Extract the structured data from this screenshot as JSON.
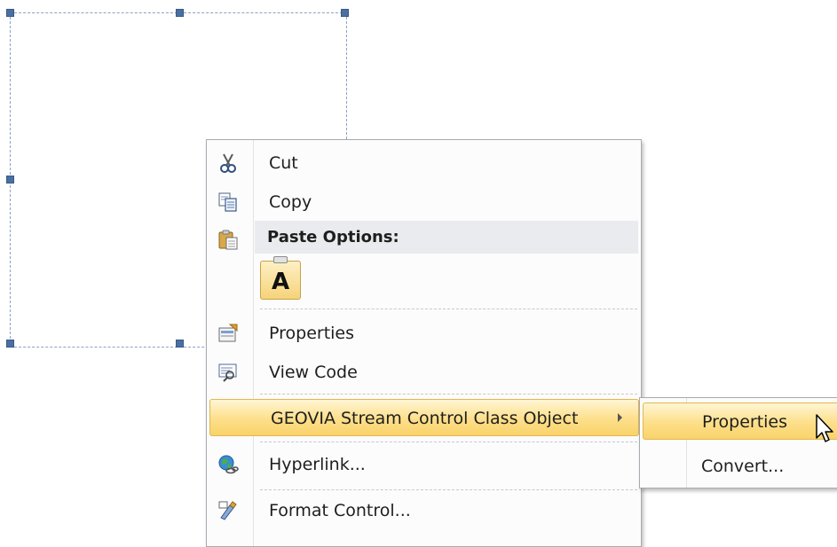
{
  "context_menu": {
    "items": {
      "cut": {
        "label": "Cut",
        "icon": "scissors-icon"
      },
      "copy": {
        "label": "Copy",
        "icon": "copy-icon"
      },
      "paste_options_header": {
        "label": "Paste Options:",
        "icon": "paste-icon"
      },
      "paste_keep_text": {
        "glyph": "A",
        "icon": "paste-keep-text-icon"
      },
      "properties": {
        "label": "Properties",
        "icon": "properties-icon"
      },
      "view_code": {
        "label": "View Code",
        "icon": "view-code-icon"
      },
      "object": {
        "label": "GEOVIA Stream Control Class Object",
        "has_submenu": true
      },
      "hyperlink": {
        "label": "Hyperlink...",
        "icon": "hyperlink-globe-icon"
      },
      "format_control": {
        "label": "Format Control...",
        "icon": "format-control-icon"
      }
    }
  },
  "submenu": {
    "items": {
      "properties": {
        "label": "Properties"
      },
      "convert": {
        "label": "Convert..."
      }
    }
  },
  "colors": {
    "highlight": "#fddf8a",
    "handle": "#4a6fa0",
    "frame_border": "#8aa2c4"
  }
}
